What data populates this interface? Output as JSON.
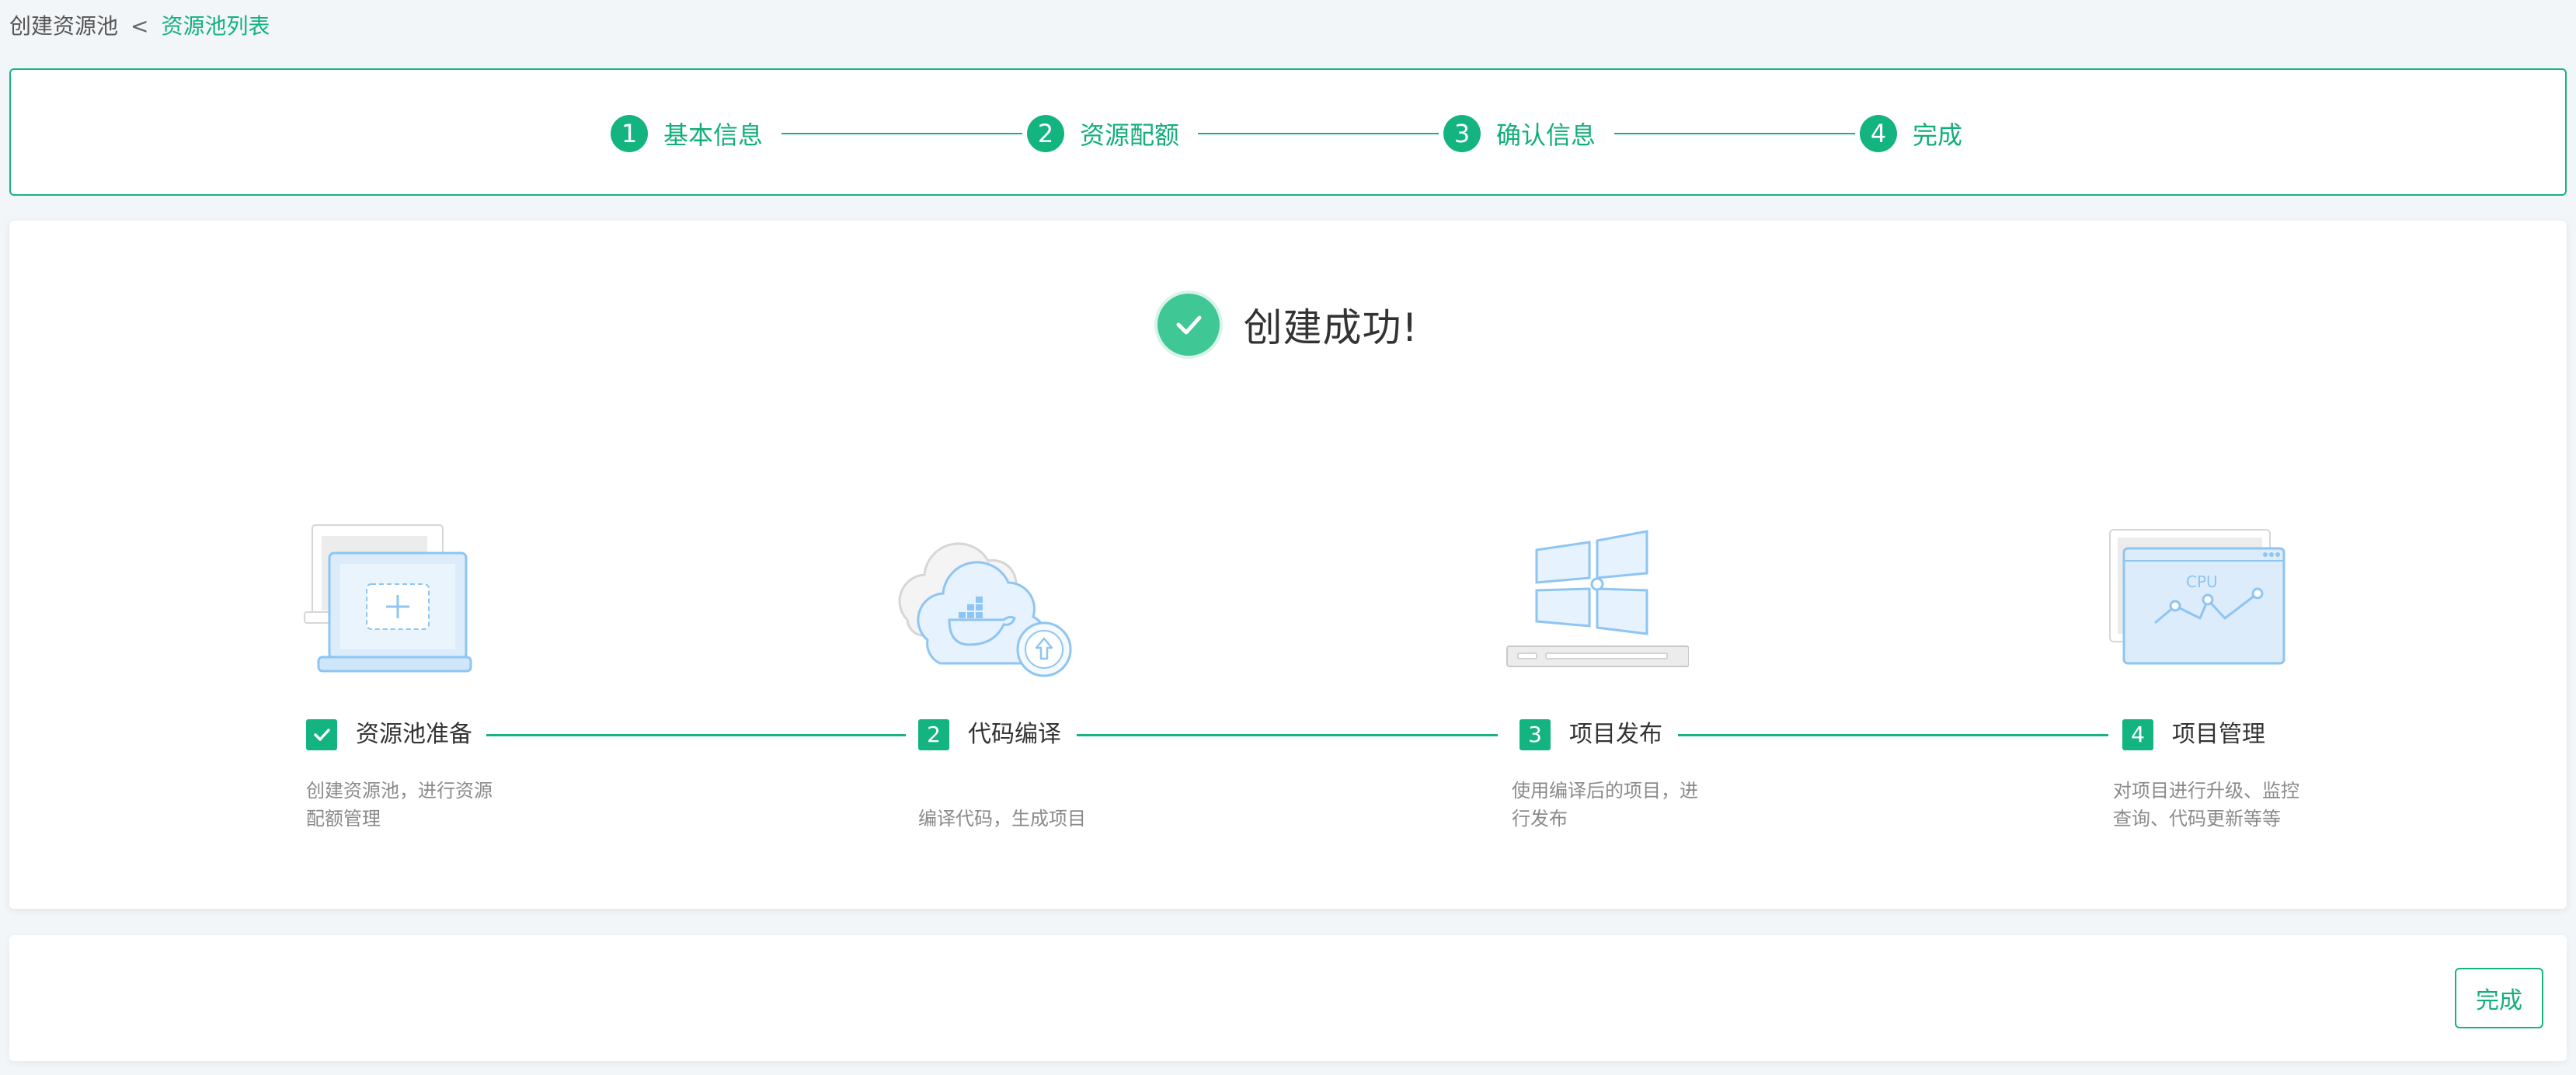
{
  "breadcrumb": {
    "root": "创建资源池",
    "separator": "<",
    "link": "资源池列表"
  },
  "steps": [
    {
      "num": "1",
      "label": "基本信息"
    },
    {
      "num": "2",
      "label": "资源配额"
    },
    {
      "num": "3",
      "label": "确认信息"
    },
    {
      "num": "4",
      "label": "完成"
    }
  ],
  "success": {
    "title": "创建成功!",
    "icon": "check-circle-icon"
  },
  "flow": [
    {
      "num": "",
      "icon": "check-icon",
      "label": "资源池准备",
      "desc": "创建资源池，进行资源配额管理",
      "illustration": "laptop-add-icon"
    },
    {
      "num": "2",
      "label": "代码编译",
      "desc": "编译代码，生成项目",
      "illustration": "cloud-docker-icon"
    },
    {
      "num": "3",
      "label": "项目发布",
      "desc": "使用编译后的项目，进行发布",
      "illustration": "windows-server-icon"
    },
    {
      "num": "4",
      "label": "项目管理",
      "desc": "对项目进行升级、监控查询、代码更新等等",
      "illustration": "cpu-monitor-icon"
    }
  ],
  "cpu_label": "CPU",
  "footer": {
    "done_label": "完成"
  },
  "colors": {
    "accent": "#13b47f",
    "accent_text": "#13ae7b",
    "illustration_blue": "#8ec5f2"
  }
}
